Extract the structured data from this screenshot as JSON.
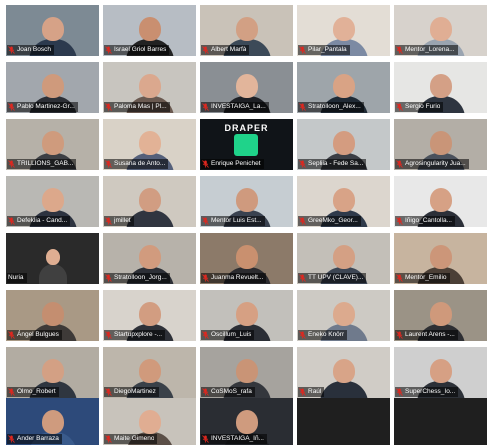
{
  "gallery": {
    "participants": [
      {
        "name": "Joan Bosch",
        "muted": true,
        "bg": "#7d8a94",
        "shirt": "#2c3a4e",
        "skin": "#d6a287"
      },
      {
        "name": "Israel Griol Barres",
        "muted": true,
        "bg": "#b7bdc4",
        "shirt": "#222222",
        "skin": "#c98f70",
        "active": true
      },
      {
        "name": "Albert Marfà",
        "muted": true,
        "bg": "#c9c2b8",
        "shirt": "#3c4a58",
        "skin": "#d2a084"
      },
      {
        "name": "Pilar_Pantala",
        "muted": true,
        "bg": "#e3ddd5",
        "shirt": "#7c8aa3",
        "skin": "#e1b198"
      },
      {
        "name": "Mentor_Lorena...",
        "muted": true,
        "bg": "#d7d2cc",
        "shirt": "#9aa4b0",
        "skin": "#e0ae94"
      },
      {
        "name": "Pablo Martinez-Gr...",
        "muted": true,
        "bg": "#a2a7ad",
        "shirt": "#2c2f36",
        "skin": "#cf9a7c"
      },
      {
        "name": "Paloma Mas | Pl...",
        "muted": true,
        "bg": "#c8c5bf",
        "shirt": "#6a5950",
        "skin": "#dba88e"
      },
      {
        "name": "INVESTAIGA_La...",
        "muted": true,
        "bg": "#8a8f94",
        "shirt": "#1e2025",
        "skin": "#e2b59b"
      },
      {
        "name": "Stratolloon_Alex...",
        "muted": true,
        "bg": "#9ea5aa",
        "shirt": "#1f2a35",
        "skin": "#d9a385"
      },
      {
        "name": "Sergio Furio",
        "muted": true,
        "bg": "#e6e6e4",
        "shirt": "#2e3540",
        "skin": "#d4a086"
      },
      {
        "name": "TRILLIONS_GAB...",
        "muted": true,
        "bg": "#b6b1a8",
        "shirt": "#3c3f44",
        "skin": "#cf9b7d"
      },
      {
        "name": "Susana de Anto...",
        "muted": true,
        "bg": "#d9d2c7",
        "shirt": "#55607a",
        "skin": "#e2b296"
      },
      {
        "name": "Enrique Penichet",
        "muted": true,
        "logo": true,
        "bg": "#101418",
        "shirt": "#2a2f3a",
        "skin": "#d6a488"
      },
      {
        "name": "Sepliia - Fede Sa...",
        "muted": true,
        "bg": "#c4c8c9",
        "shirt": "#3b3e45",
        "skin": "#d49c80"
      },
      {
        "name": "Agrosingularity Jua...",
        "muted": true,
        "bg": "#b3aea6",
        "shirt": "#4a515c",
        "skin": "#c99578"
      },
      {
        "name": "Defeklia - Cand...",
        "muted": true,
        "bg": "#b9b8b4",
        "shirt": "#2d3340",
        "skin": "#dca88b"
      },
      {
        "name": "jmillet",
        "muted": true,
        "bg": "#cfc9c0",
        "shirt": "#303540",
        "skin": "#d19d82"
      },
      {
        "name": "Mentor Luis Est...",
        "muted": true,
        "bg": "#c6cdd2",
        "shirt": "#3a4250",
        "skin": "#cf9a7e"
      },
      {
        "name": "GreeMko_Geor...",
        "muted": true,
        "bg": "#dcd6ce",
        "shirt": "#2f3a4b",
        "skin": "#d8a387"
      },
      {
        "name": "Iñigo_Cantolla...",
        "muted": true,
        "bg": "#e8e8e8",
        "shirt": "#2c3039",
        "skin": "#d6a185"
      },
      {
        "name": "Nuria",
        "muted": false,
        "bg": "#2a2a2a",
        "shirt": "#404040",
        "skin": "#dfae92",
        "small": true
      },
      {
        "name": "Stratolloon_Jorg...",
        "muted": true,
        "bg": "#b7b2aa",
        "shirt": "#2c2f36",
        "skin": "#d19b7e"
      },
      {
        "name": "Juanma Revuelt...",
        "muted": true,
        "bg": "#8c7a69",
        "shirt": "#2b2b2f",
        "skin": "#c9906f"
      },
      {
        "name": "TT UPV (CLAVE)...",
        "muted": true,
        "bg": "#c3bfb8",
        "shirt": "#3d4654",
        "skin": "#d4a084"
      },
      {
        "name": "Mentor_Emilio",
        "muted": true,
        "bg": "#c7b49f",
        "shirt": "#4b3f36",
        "skin": "#cc9679"
      },
      {
        "name": "Ángel Bulgues",
        "muted": true,
        "bg": "#a99985",
        "shirt": "#3e3a38",
        "skin": "#c48e70"
      },
      {
        "name": "Startupxplore -...",
        "muted": true,
        "bg": "#d8d3cc",
        "shirt": "#2e3138",
        "skin": "#d29d81"
      },
      {
        "name": "Oscillum_Luis",
        "muted": true,
        "bg": "#c2c0bb",
        "shirt": "#2b2e35",
        "skin": "#d6a083"
      },
      {
        "name": "Eneko Knörr",
        "muted": true,
        "bg": "#cdcac4",
        "shirt": "#6f7a8c",
        "skin": "#dcaa8e"
      },
      {
        "name": "Laurent Arens -...",
        "muted": true,
        "bg": "#9b9386",
        "shirt": "#2e2f33",
        "skin": "#cf997b"
      },
      {
        "name": "Olmo_Robert",
        "muted": true,
        "bg": "#b2aca2",
        "shirt": "#2f3640",
        "skin": "#d3a084"
      },
      {
        "name": "DiegoMartinez",
        "muted": true,
        "bg": "#bdb6ab",
        "shirt": "#3a4149",
        "skin": "#d09a7c"
      },
      {
        "name": "CoSMoS_rafa",
        "muted": true,
        "bg": "#a6a39e",
        "shirt": "#34373d",
        "skin": "#c99476"
      },
      {
        "name": "Raúl",
        "muted": true,
        "bg": "#d0ccc6",
        "shirt": "#29303b",
        "skin": "#d8a488"
      },
      {
        "name": "SuperChess_Io...",
        "muted": true,
        "bg": "#cfcfcf",
        "shirt": "#2d3138",
        "skin": "#d6a084"
      },
      {
        "name": "Ander Barraza",
        "muted": true,
        "bg": "#2d4a7a",
        "shirt": "#3a5b8c",
        "skin": "#cf9b7e"
      },
      {
        "name": "Maite Gimeno",
        "muted": true,
        "bg": "#c8c3bb",
        "shirt": "#5b4f47",
        "skin": "#e0ad92"
      },
      {
        "name": "INVESTAIGA_Iñ...",
        "muted": true,
        "bg": "#2a2d33",
        "shirt": "#1f2227",
        "skin": "#cf9b7e"
      },
      {
        "name": "",
        "empty": true
      },
      {
        "name": "",
        "empty": true
      }
    ]
  },
  "colors": {
    "active_speaker_border": "#f2e600",
    "muted_icon": "#e0271f",
    "nameplate_text": "#ffffff"
  },
  "icons": {
    "muted": "microphone-muted-icon"
  },
  "logo_tile": {
    "word": "DRAPER"
  }
}
